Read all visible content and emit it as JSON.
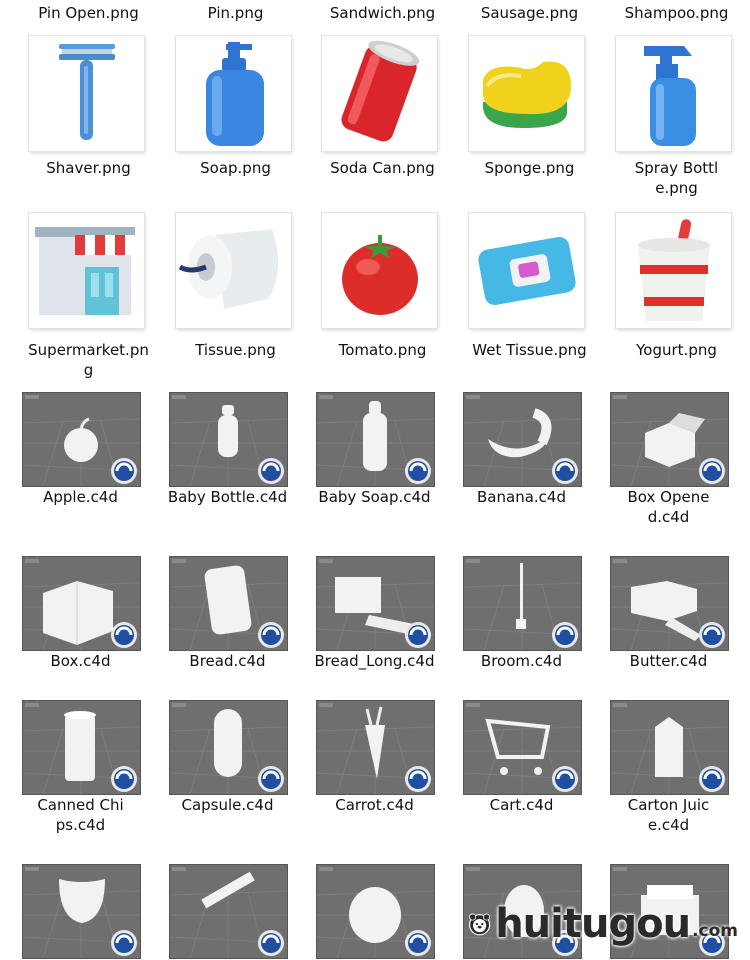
{
  "files": [
    {
      "name": "Pin Open.png",
      "icon": "pin-open-icon"
    },
    {
      "name": "Pin.png",
      "icon": "pin-icon"
    },
    {
      "name": "Sandwich.png",
      "icon": "sandwich-icon"
    },
    {
      "name": "Sausage.png",
      "icon": "sausage-icon"
    },
    {
      "name": "Shampoo.png",
      "icon": "shampoo-icon"
    },
    {
      "name": "Shaver.png",
      "icon": "shaver-icon"
    },
    {
      "name": "Soap.png",
      "icon": "soap-icon"
    },
    {
      "name": "Soda Can.png",
      "icon": "soda-can-icon"
    },
    {
      "name": "Sponge.png",
      "icon": "sponge-icon"
    },
    {
      "name": "Spray Bottle.png",
      "icon": "spray-bottle-icon"
    },
    {
      "name": "Supermarket.png",
      "icon": "supermarket-icon"
    },
    {
      "name": "Tissue.png",
      "icon": "tissue-icon"
    },
    {
      "name": "Tomato.png",
      "icon": "tomato-icon"
    },
    {
      "name": "Wet Tissue.png",
      "icon": "wet-tissue-icon"
    },
    {
      "name": "Yogurt.png",
      "icon": "yogurt-icon"
    },
    {
      "name": "Apple.c4d",
      "icon": "apple-model-icon"
    },
    {
      "name": "Baby Bottle.c4d",
      "icon": "baby-bottle-model-icon"
    },
    {
      "name": "Baby Soap.c4d",
      "icon": "baby-soap-model-icon"
    },
    {
      "name": "Banana.c4d",
      "icon": "banana-model-icon"
    },
    {
      "name": "Box Opened.c4d",
      "icon": "box-opened-model-icon"
    },
    {
      "name": "Box.c4d",
      "icon": "box-model-icon"
    },
    {
      "name": "Bread.c4d",
      "icon": "bread-model-icon"
    },
    {
      "name": "Bread_Long.c4d",
      "icon": "bread-long-model-icon"
    },
    {
      "name": "Broom.c4d",
      "icon": "broom-model-icon"
    },
    {
      "name": "Butter.c4d",
      "icon": "butter-model-icon"
    },
    {
      "name": "Canned Chips.c4d",
      "icon": "canned-chips-model-icon"
    },
    {
      "name": "Capsule.c4d",
      "icon": "capsule-model-icon"
    },
    {
      "name": "Carrot.c4d",
      "icon": "carrot-model-icon"
    },
    {
      "name": "Cart.c4d",
      "icon": "cart-model-icon"
    },
    {
      "name": "Carton Juice.c4d",
      "icon": "carton-juice-model-icon"
    },
    {
      "name": "",
      "icon": "cup-model-icon"
    },
    {
      "name": "",
      "icon": "comb-model-icon"
    },
    {
      "name": "",
      "icon": "diaper-model-icon"
    },
    {
      "name": "",
      "icon": "egg-model-icon"
    },
    {
      "name": "",
      "icon": "container-model-icon"
    }
  ],
  "watermark": {
    "brand": "huitugou",
    "suffix": ".com"
  },
  "colors": {
    "c4d_bg": "#6f6f6f",
    "cinema4d_badge": "#1f4fa0"
  }
}
